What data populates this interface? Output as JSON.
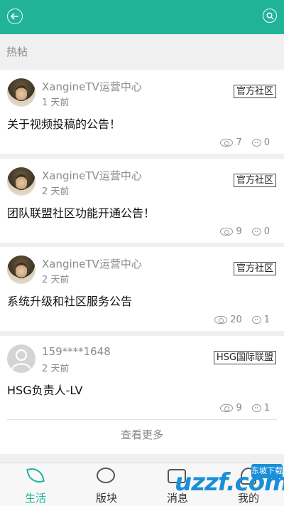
{
  "section_title": "热帖",
  "posts": [
    {
      "author": "XangineTV运营中心",
      "time": "1 天前",
      "tag": "官方社区",
      "title": "关于视频投稿的公告！",
      "views": "7",
      "comments": "0"
    },
    {
      "author": "XangineTV运营中心",
      "time": "2 天前",
      "tag": "官方社区",
      "title": "团队联盟社区功能开通公告！",
      "views": "9",
      "comments": "0"
    },
    {
      "author": "XangineTV运营中心",
      "time": "2 天前",
      "tag": "官方社区",
      "title": "系统升级和社区服务公告",
      "views": "20",
      "comments": "1"
    },
    {
      "author": "159****1648",
      "time": "2 天前",
      "tag": "HSG国际联盟",
      "title": "HSG负责人-LV",
      "views": "9",
      "comments": "1"
    }
  ],
  "more_label": "查看更多",
  "tabs": [
    {
      "label": "生活",
      "icon": "leaf-icon"
    },
    {
      "label": "版块",
      "icon": "chat-bubbles-icon"
    },
    {
      "label": "消息",
      "icon": "message-icon"
    },
    {
      "label": "我的",
      "icon": "person-icon"
    }
  ],
  "watermark": {
    "text": "uzzf.com",
    "badge": "东坡下载"
  },
  "colors": {
    "accent": "#20b39a",
    "watermark": "#1a8fd8"
  }
}
